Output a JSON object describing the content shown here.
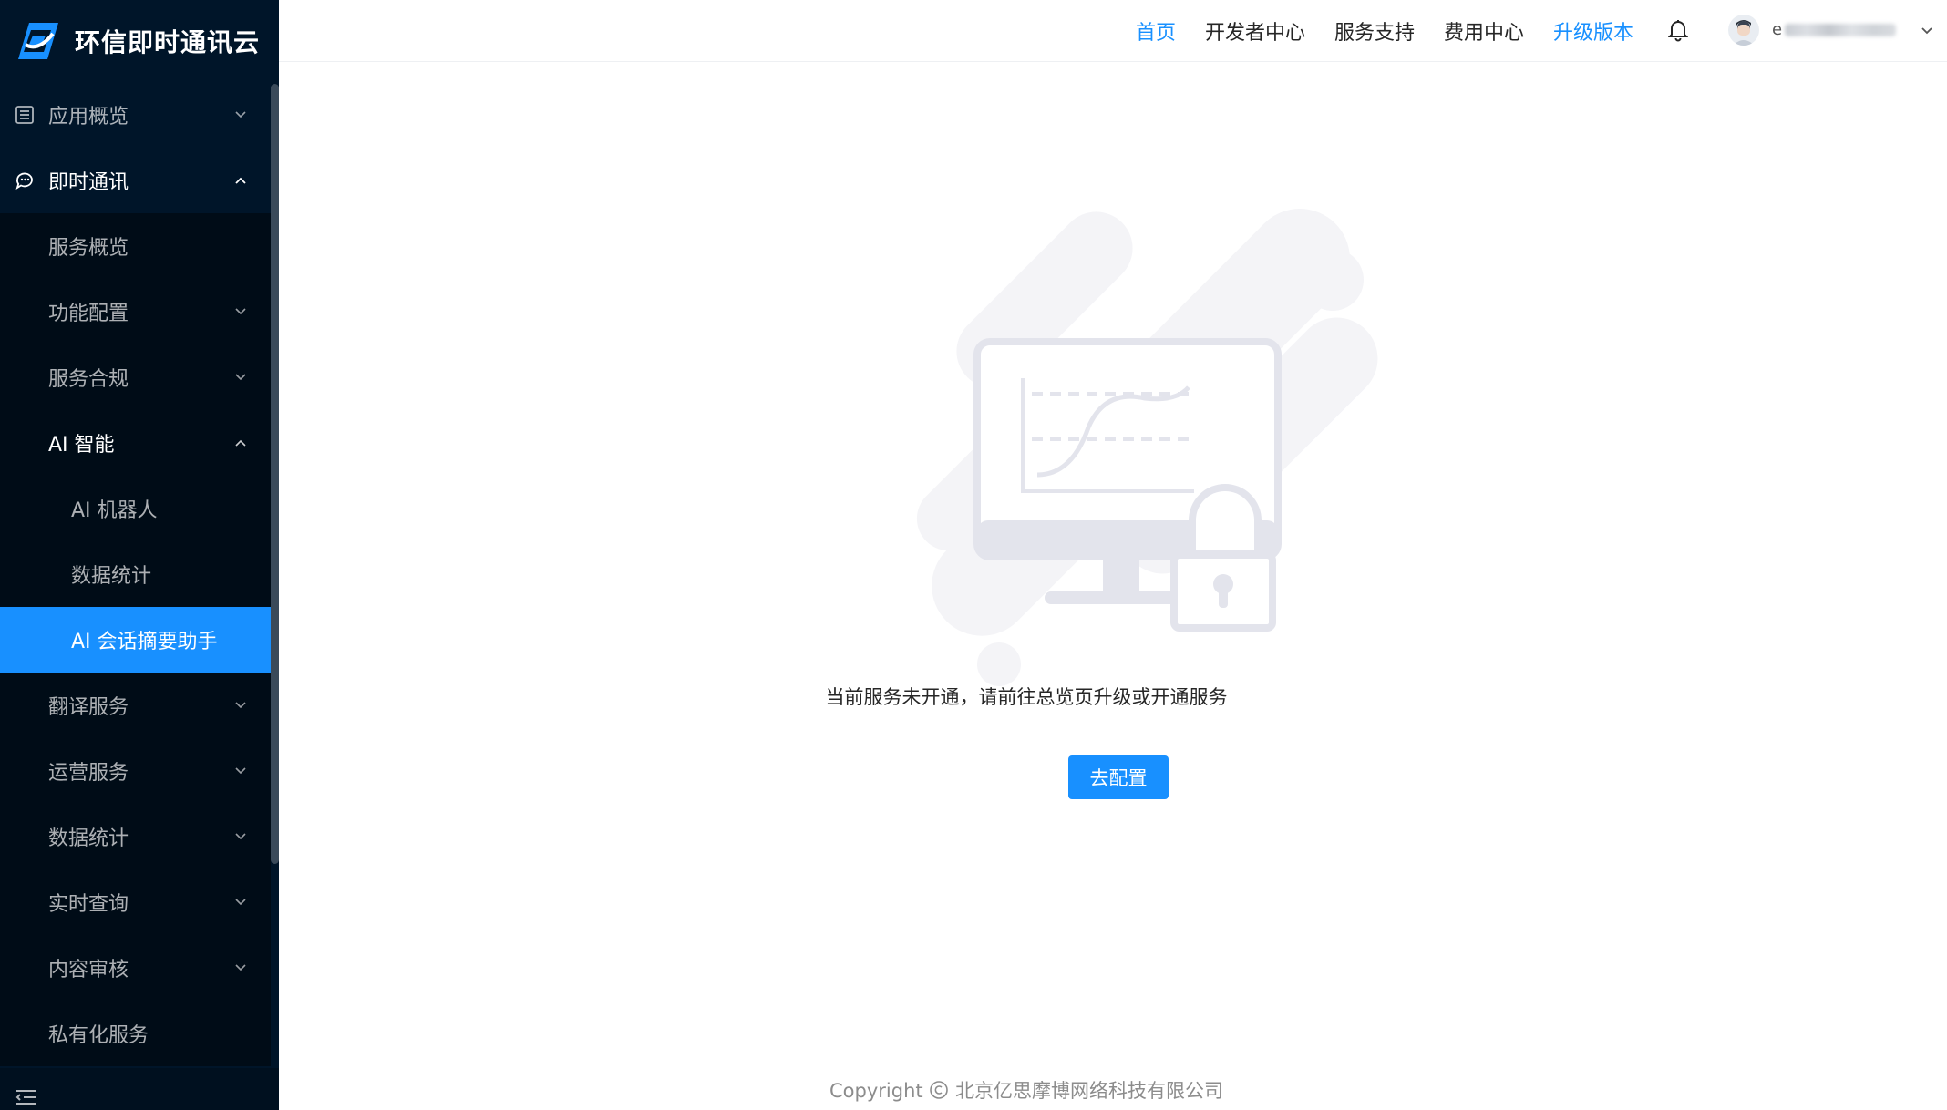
{
  "brand": {
    "name": "环信即时通讯云",
    "logo_color": "#1890ff"
  },
  "sidebar": {
    "items": [
      {
        "label": "应用概览",
        "icon": "list-icon",
        "expanded": false
      },
      {
        "label": "即时通讯",
        "icon": "chat-icon",
        "expanded": true
      }
    ],
    "sub_items": [
      {
        "label": "服务概览"
      },
      {
        "label": "功能配置"
      },
      {
        "label": "服务合规"
      },
      {
        "label": "AI 智能"
      }
    ],
    "ai_items": [
      {
        "label": "AI 机器人"
      },
      {
        "label": "数据统计"
      },
      {
        "label": "AI 会话摘要助手",
        "active": true
      }
    ],
    "more_items": [
      {
        "label": "翻译服务"
      },
      {
        "label": "运营服务"
      },
      {
        "label": "数据统计"
      },
      {
        "label": "实时查询"
      },
      {
        "label": "内容审核"
      },
      {
        "label": "私有化服务"
      }
    ],
    "active_color": "#1890ff",
    "background": "#001529"
  },
  "header": {
    "nav": [
      {
        "label": "首页",
        "highlight": true
      },
      {
        "label": "开发者中心",
        "highlight": false
      },
      {
        "label": "服务支持",
        "highlight": false
      },
      {
        "label": "费用中心",
        "highlight": false
      },
      {
        "label": "升级版本",
        "highlight": true
      }
    ],
    "user_initial": "e"
  },
  "main": {
    "empty_message": "当前服务未开通，请前往总览页升级或开通服务",
    "config_button_label": "去配置"
  },
  "footer": {
    "copyright_label": "Copyright",
    "company": "北京亿思摩博网络科技有限公司"
  }
}
